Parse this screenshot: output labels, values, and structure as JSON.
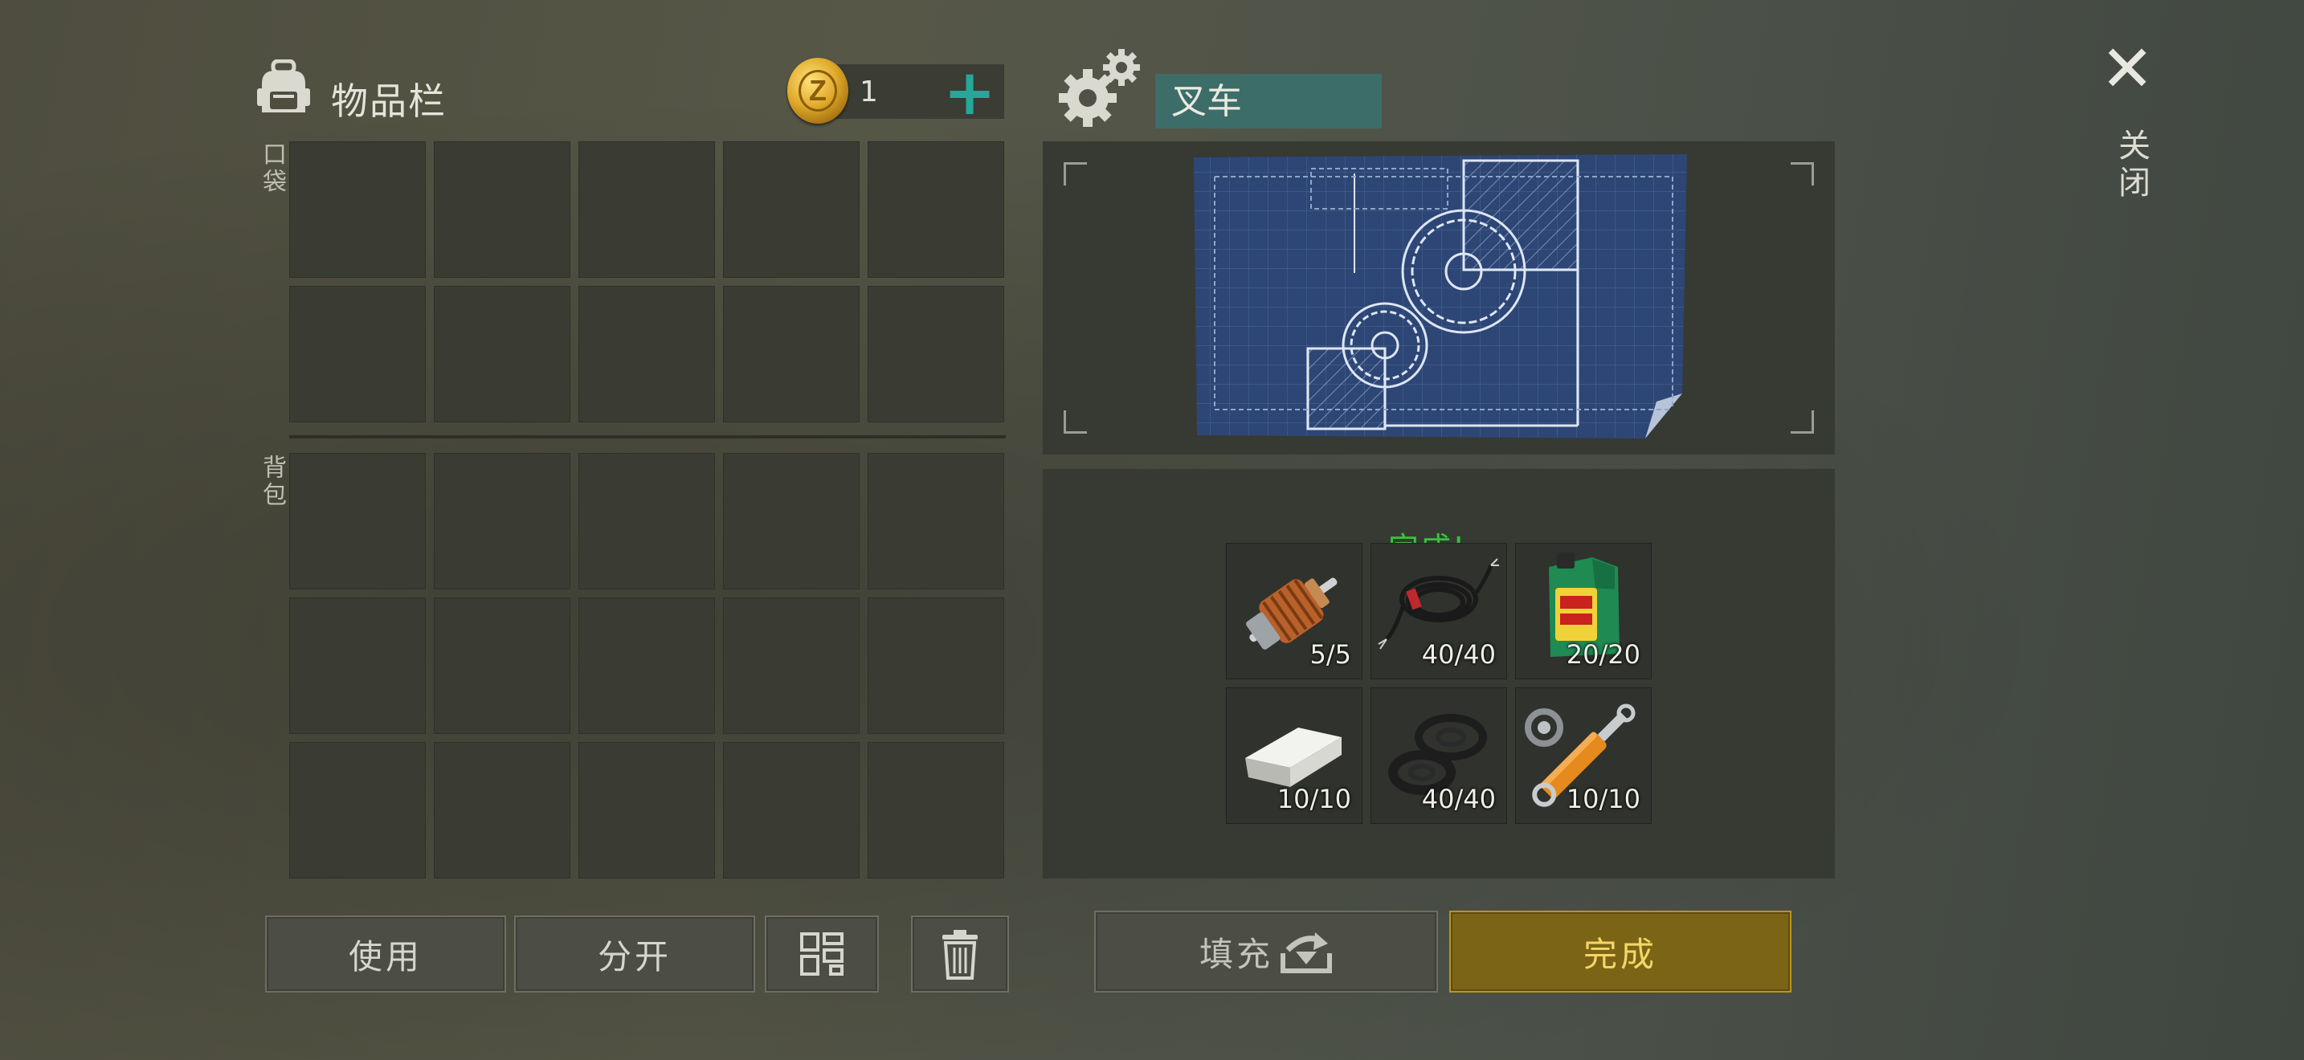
{
  "inventory": {
    "title": "物品栏",
    "coin_count": "1",
    "sections": {
      "pocket": "口袋",
      "backpack": "背包"
    }
  },
  "buttons": {
    "use": "使用",
    "split": "分开",
    "fill": "填充",
    "complete": "完成"
  },
  "craft": {
    "name": "叉车",
    "status": "完成!",
    "items": [
      {
        "icon": "armature-icon",
        "count": "5/5"
      },
      {
        "icon": "wire-coil-icon",
        "count": "40/40"
      },
      {
        "icon": "motor-oil-icon",
        "count": "20/20"
      },
      {
        "icon": "metal-ingot-icon",
        "count": "10/10"
      },
      {
        "icon": "rubber-seal-icon",
        "count": "40/40"
      },
      {
        "icon": "hydraulic-cylinder-icon",
        "count": "10/10"
      }
    ]
  },
  "close": {
    "label": "关闭"
  },
  "colors": {
    "accent_teal": "#27a79a",
    "gold": "#7c6417",
    "done_green": "#37c33b"
  }
}
